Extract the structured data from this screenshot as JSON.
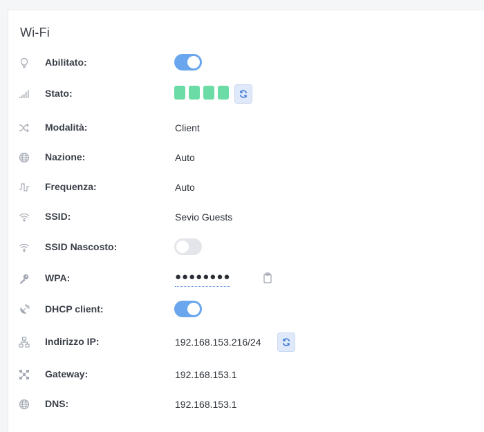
{
  "card": {
    "title": "Wi-Fi"
  },
  "fields": {
    "enabled": {
      "label": "Abilitato:",
      "icon": "bulb-icon",
      "value": true
    },
    "status": {
      "label": "Stato:",
      "icon": "signal-bars-icon",
      "signal_bars": 4,
      "bar_color": "#6cdca6"
    },
    "mode": {
      "label": "Modalità:",
      "icon": "shuffle-icon",
      "value": "Client"
    },
    "country": {
      "label": "Nazione:",
      "icon": "globe-icon",
      "value": "Auto"
    },
    "frequency": {
      "label": "Frequenza:",
      "icon": "pulse-icon",
      "value": "Auto"
    },
    "ssid": {
      "label": "SSID:",
      "icon": "wifi-icon",
      "value": "Sevio Guests"
    },
    "hidden_ssid": {
      "label": "SSID Nascosto:",
      "icon": "wifi-icon",
      "value": false
    },
    "wpa": {
      "label": "WPA:",
      "icon": "key-icon",
      "masked": "●●●●●●●●"
    },
    "dhcp": {
      "label": "DHCP client:",
      "icon": "satellite-dish-icon",
      "value": true
    },
    "ip": {
      "label": "Indirizzo IP:",
      "icon": "network-icon",
      "value": "192.168.153.216/24"
    },
    "gateway": {
      "label": "Gateway:",
      "icon": "gateway-icon",
      "value": "192.168.153.1"
    },
    "dns": {
      "label": "DNS:",
      "icon": "globe-icon",
      "value": "192.168.153.1"
    }
  },
  "colors": {
    "accent": "#6aa6ee",
    "toggle_off": "#e3e5ea",
    "signal": "#6cdca6"
  }
}
